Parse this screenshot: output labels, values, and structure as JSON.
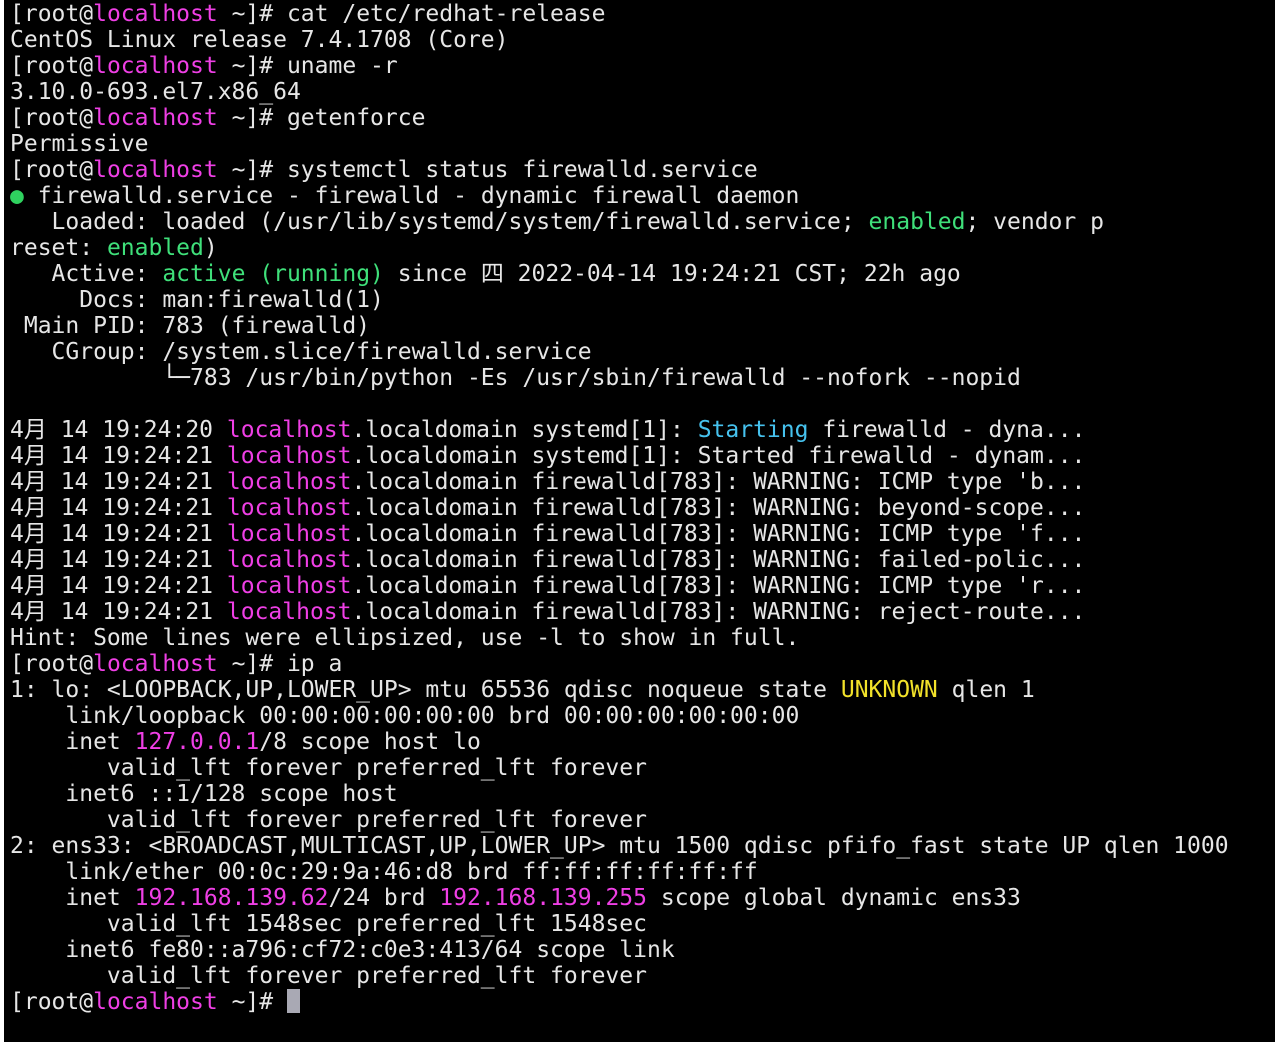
{
  "terminal": {
    "lines": [
      [
        {
          "t": "[root@"
        },
        {
          "t": "localhost",
          "c": "magenta"
        },
        {
          "t": " ~]# cat /etc/redhat-release"
        }
      ],
      [
        {
          "t": "CentOS Linux release 7.4.1708 (Core)"
        }
      ],
      [
        {
          "t": "[root@"
        },
        {
          "t": "localhost",
          "c": "magenta"
        },
        {
          "t": " ~]# uname -r"
        }
      ],
      [
        {
          "t": "3.10.0-693.el7.x86_64"
        }
      ],
      [
        {
          "t": "[root@"
        },
        {
          "t": "localhost",
          "c": "magenta"
        },
        {
          "t": " ~]# getenforce"
        }
      ],
      [
        {
          "t": "Permissive"
        }
      ],
      [
        {
          "t": "[root@"
        },
        {
          "t": "localhost",
          "c": "magenta"
        },
        {
          "t": " ~]# systemctl status firewalld.service"
        }
      ],
      [
        {
          "t": "●",
          "c": "bullet"
        },
        {
          "t": " firewalld.service - firewalld - dynamic firewall daemon"
        }
      ],
      [
        {
          "t": "   Loaded: loaded (/usr/lib/systemd/system/firewalld.service; "
        },
        {
          "t": "enabled",
          "c": "green"
        },
        {
          "t": "; vendor p"
        }
      ],
      [
        {
          "t": "reset: "
        },
        {
          "t": "enabled",
          "c": "green"
        },
        {
          "t": ")"
        }
      ],
      [
        {
          "t": "   Active: "
        },
        {
          "t": "active (running)",
          "c": "green"
        },
        {
          "t": " since 四 2022-04-14 19:24:21 CST; 22h ago"
        }
      ],
      [
        {
          "t": "     Docs: man:firewalld(1)"
        }
      ],
      [
        {
          "t": " Main PID: 783 (firewalld)"
        }
      ],
      [
        {
          "t": "   CGroup: /system.slice/firewalld.service"
        }
      ],
      [
        {
          "t": "           └─783 /usr/bin/python -Es /usr/sbin/firewalld --nofork --nopid"
        }
      ],
      [
        {
          "t": ""
        }
      ],
      [
        {
          "t": "4月 14 19:24:20 "
        },
        {
          "t": "localhost",
          "c": "magenta"
        },
        {
          "t": ".localdomain systemd[1]: "
        },
        {
          "t": "Starting",
          "c": "cyan"
        },
        {
          "t": " firewalld - dyna..."
        }
      ],
      [
        {
          "t": "4月 14 19:24:21 "
        },
        {
          "t": "localhost",
          "c": "magenta"
        },
        {
          "t": ".localdomain systemd[1]: Started firewalld - dynam..."
        }
      ],
      [
        {
          "t": "4月 14 19:24:21 "
        },
        {
          "t": "localhost",
          "c": "magenta"
        },
        {
          "t": ".localdomain firewalld[783]: WARNING: ICMP type 'b..."
        }
      ],
      [
        {
          "t": "4月 14 19:24:21 "
        },
        {
          "t": "localhost",
          "c": "magenta"
        },
        {
          "t": ".localdomain firewalld[783]: WARNING: beyond-scope..."
        }
      ],
      [
        {
          "t": "4月 14 19:24:21 "
        },
        {
          "t": "localhost",
          "c": "magenta"
        },
        {
          "t": ".localdomain firewalld[783]: WARNING: ICMP type 'f..."
        }
      ],
      [
        {
          "t": "4月 14 19:24:21 "
        },
        {
          "t": "localhost",
          "c": "magenta"
        },
        {
          "t": ".localdomain firewalld[783]: WARNING: failed-polic..."
        }
      ],
      [
        {
          "t": "4月 14 19:24:21 "
        },
        {
          "t": "localhost",
          "c": "magenta"
        },
        {
          "t": ".localdomain firewalld[783]: WARNING: ICMP type 'r..."
        }
      ],
      [
        {
          "t": "4月 14 19:24:21 "
        },
        {
          "t": "localhost",
          "c": "magenta"
        },
        {
          "t": ".localdomain firewalld[783]: WARNING: reject-route..."
        }
      ],
      [
        {
          "t": "Hint: Some lines were ellipsized, use -l to show in full."
        }
      ],
      [
        {
          "t": "[root@"
        },
        {
          "t": "localhost",
          "c": "magenta"
        },
        {
          "t": " ~]# ip a"
        }
      ],
      [
        {
          "t": "1: lo: <LOOPBACK,UP,LOWER_UP> mtu 65536 qdisc noqueue state "
        },
        {
          "t": "UNKNOWN",
          "c": "yellow"
        },
        {
          "t": " qlen 1"
        }
      ],
      [
        {
          "t": "    link/loopback 00:00:00:00:00:00 brd 00:00:00:00:00:00"
        }
      ],
      [
        {
          "t": "    inet "
        },
        {
          "t": "127.0.0.1",
          "c": "magenta"
        },
        {
          "t": "/8 scope host lo"
        }
      ],
      [
        {
          "t": "       valid_lft forever preferred_lft forever"
        }
      ],
      [
        {
          "t": "    inet6 ::1/128 scope host"
        }
      ],
      [
        {
          "t": "       valid_lft forever preferred_lft forever"
        }
      ],
      [
        {
          "t": "2: ens33: <BROADCAST,MULTICAST,UP,LOWER_UP> mtu 1500 qdisc pfifo_fast state UP qlen 1000"
        }
      ],
      [
        {
          "t": "    link/ether 00:0c:29:9a:46:d8 brd ff:ff:ff:ff:ff:ff"
        }
      ],
      [
        {
          "t": "    inet "
        },
        {
          "t": "192.168.139.62",
          "c": "magenta"
        },
        {
          "t": "/24 brd "
        },
        {
          "t": "192.168.139.255",
          "c": "magenta"
        },
        {
          "t": " scope global dynamic ens33"
        }
      ],
      [
        {
          "t": "       valid_lft 1548sec preferred_lft 1548sec"
        }
      ],
      [
        {
          "t": "    inet6 fe80::a796:cf72:c0e3:413/64 scope link"
        }
      ],
      [
        {
          "t": "       valid_lft forever preferred_lft forever"
        }
      ],
      [
        {
          "t": "[root@"
        },
        {
          "t": "localhost",
          "c": "magenta"
        },
        {
          "t": " ~]# "
        },
        {
          "cursor": true
        }
      ]
    ]
  },
  "colors": {
    "background": "#000000",
    "foreground": "#e6e6e6",
    "magenta": "#ef3fe5",
    "green": "#3fe07a",
    "cyan": "#46c2ee",
    "yellow": "#f2e22a",
    "cursor": "#a9a9b4"
  }
}
